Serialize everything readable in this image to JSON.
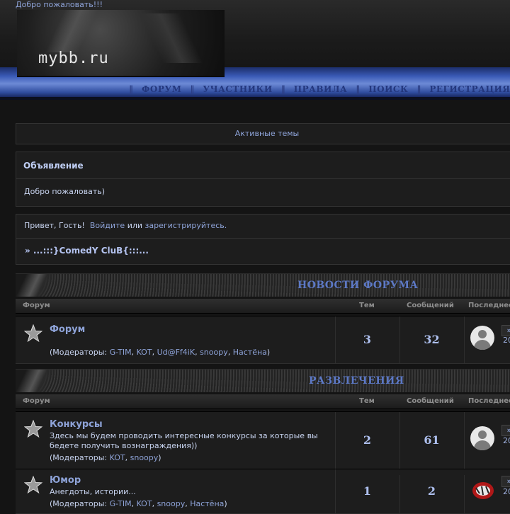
{
  "header": {
    "welcome": "Добро пожаловать!!!",
    "logo_text": "mybb.ru",
    "nav": [
      "ФОРУМ",
      "УЧАСТНИКИ",
      "ПРАВИЛА",
      "ПОИСК",
      "РЕГИСТРАЦИЯ"
    ]
  },
  "active_topics": "Активные темы",
  "announcement": {
    "title": "Объявление",
    "body": "Добро пожаловать)"
  },
  "guest": {
    "hello": "Привет, Гость!",
    "login": "Войдите",
    "or": "или",
    "register": "зарегистрируйтесь",
    "period": ".",
    "site_name": "» ...:::}ComedY CluB{:::..."
  },
  "columns": {
    "forum": "Форум",
    "topics": "Тем",
    "posts": "Сообщений",
    "last": "Последнее"
  },
  "categories": [
    {
      "name": "НОВОСТИ ФОРУМА",
      "forums": [
        {
          "name": "Форум",
          "desc": "",
          "mods_prefix": "(Модераторы: ",
          "mods": [
            "G-TIM",
            "KOT",
            "Ud@Ff4iK",
            "snoopy",
            "Настёна"
          ],
          "mods_suffix": ")",
          "topics": "3",
          "posts": "32",
          "year": "20"
        }
      ]
    },
    {
      "name": "РАЗВЛЕЧЕНИЯ",
      "forums": [
        {
          "name": "Конкурсы",
          "desc": "Здесь мы будем проводить интересные конкурсы за которые вы бедете получить вознаграждения))",
          "mods_prefix": "(Модераторы: ",
          "mods": [
            "KOT",
            "snoopy"
          ],
          "mods_suffix": ")",
          "topics": "2",
          "posts": "61",
          "year": "20"
        },
        {
          "name": "Юмор",
          "desc": "Анегдоты, истории...",
          "mods_prefix": "(Модераторы: ",
          "mods": [
            "G-TIM",
            "KOT",
            "snoopy",
            "Настёна"
          ],
          "mods_suffix": ")",
          "topics": "1",
          "posts": "2",
          "year": "20"
        }
      ]
    }
  ],
  "jump_symbol": "»",
  "colors": {
    "accent": "#8ea3d8",
    "nav_blue": "#3a5ab6",
    "category_title": "#5d79c6"
  }
}
